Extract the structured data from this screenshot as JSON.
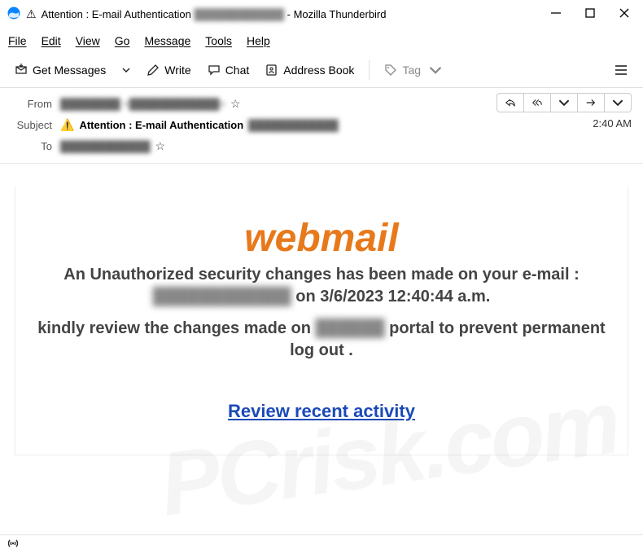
{
  "window": {
    "title_prefix": "Attention : E-mail Authentication",
    "title_redacted": "████████████",
    "title_suffix": "- Mozilla Thunderbird"
  },
  "menu": {
    "file": "File",
    "edit": "Edit",
    "view": "View",
    "go": "Go",
    "message": "Message",
    "tools": "Tools",
    "help": "Help"
  },
  "toolbar": {
    "get_messages": "Get Messages",
    "write": "Write",
    "chat": "Chat",
    "address_book": "Address Book",
    "tag": "Tag"
  },
  "headers": {
    "from_label": "From",
    "from_value": "████████ <████████████>",
    "subject_label": "Subject",
    "subject_prefix": "Attention : E-mail Authentication",
    "subject_redacted": "████████████",
    "to_label": "To",
    "to_value": "████████████",
    "time": "2:40 AM"
  },
  "body": {
    "brand": "webmail",
    "line1a": "An Unauthorized security changes has been made on your e-mail :",
    "line1_redacted": "████████████",
    "line1b": "on 3/6/2023 12:40:44 a.m.",
    "line2a": "kindly review the changes made on",
    "line2_redacted": "██████",
    "line2b": "portal to prevent permanent log out .",
    "link": "Review recent activity"
  },
  "watermark": "PCrisk.com"
}
